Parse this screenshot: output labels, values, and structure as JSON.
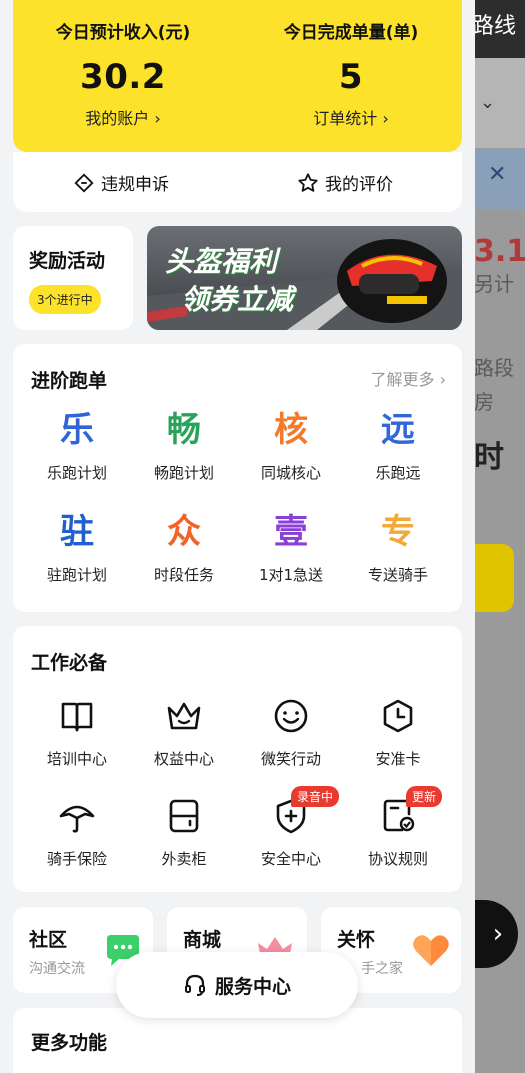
{
  "background": {
    "top_text": "路线",
    "value_text": "3.1",
    "side_text_1": "另计",
    "side_text_2": "路段",
    "side_text_3": "房",
    "side_text_4": "时"
  },
  "earnings": {
    "income_label": "今日预计收入(元)",
    "income_value": "30.2",
    "income_link": "我的账户 ›",
    "orders_label": "今日完成单量(单)",
    "orders_value": "5",
    "orders_link": "订单统计 ›"
  },
  "appeal": {
    "violation_label": "违规申诉",
    "rating_label": "我的评价"
  },
  "reward": {
    "title": "奖励活动",
    "badge": "3个进行中"
  },
  "banner": {
    "line1": "头盔福利",
    "line2": "领券立减"
  },
  "advanced": {
    "title": "进阶跑单",
    "more": "了解更多 ›",
    "items": [
      {
        "glyph": "乐",
        "label": "乐跑计划",
        "color": "#2f63d6"
      },
      {
        "glyph": "畅",
        "label": "畅跑计划",
        "color": "#2aa35a"
      },
      {
        "glyph": "核",
        "label": "同城核心",
        "color": "#f27a2a"
      },
      {
        "glyph": "远",
        "label": "乐跑远",
        "color": "#3267d8"
      },
      {
        "glyph": "驻",
        "label": "驻跑计划",
        "color": "#1f5fcf"
      },
      {
        "glyph": "众",
        "label": "时段任务",
        "color": "#f0642a"
      },
      {
        "glyph": "壹",
        "label": "1对1急送",
        "color": "#8a3fd6"
      },
      {
        "glyph": "专",
        "label": "专送骑手",
        "color": "#f2a93a"
      }
    ]
  },
  "essentials": {
    "title": "工作必备",
    "items": [
      {
        "icon": "book-icon",
        "label": "培训中心",
        "badge": ""
      },
      {
        "icon": "crown-icon",
        "label": "权益中心",
        "badge": ""
      },
      {
        "icon": "smile-icon",
        "label": "微笑行动",
        "badge": ""
      },
      {
        "icon": "clock-card-icon",
        "label": "安准卡",
        "badge": ""
      },
      {
        "icon": "umbrella-icon",
        "label": "骑手保险",
        "badge": ""
      },
      {
        "icon": "locker-icon",
        "label": "外卖柜",
        "badge": ""
      },
      {
        "icon": "shield-plus-icon",
        "label": "安全中心",
        "badge": "录音中"
      },
      {
        "icon": "doc-check-icon",
        "label": "协议规则",
        "badge": "更新"
      }
    ]
  },
  "mini_cards": [
    {
      "title": "社区",
      "sub": "沟通交流"
    },
    {
      "title": "商城",
      "sub": ""
    },
    {
      "title": "关怀",
      "sub": "手之家"
    }
  ],
  "service_center": {
    "label": "服务中心"
  },
  "more_functions": {
    "title": "更多功能"
  },
  "colors": {
    "yellow": "#fce22b",
    "badge_red": "#e83a2f"
  }
}
